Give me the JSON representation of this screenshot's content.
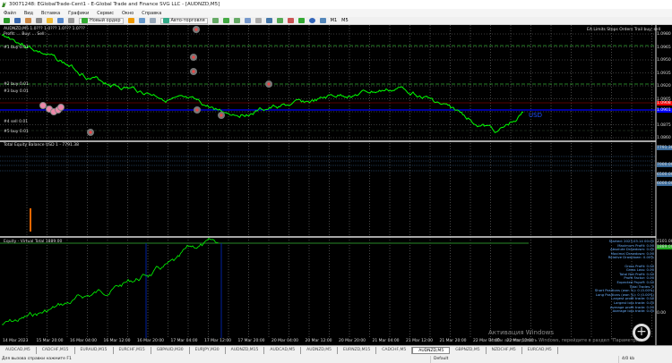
{
  "window": {
    "title": "30071248: EGlobalTrade-Cent1 - E-Global Trade and Finance SVG LLC - [AUDNZD,M5]"
  },
  "menu": [
    "Файл",
    "Вид",
    "Вставка",
    "Графики",
    "Сервис",
    "Окно",
    "Справка"
  ],
  "toolbar": {
    "new_order": "Новый ордер",
    "autotrading": "Авто-торговля",
    "periods": [
      "M1",
      "M5"
    ]
  },
  "chart": {
    "symbol_line": "AUDNZD,M5 1.0??? 1.0??? 1.0??? 1.0???",
    "ea_line": "Profit: ... Buy: ... Sell: ...",
    "right_info": "EA Limits Stops Orders Trail buy: sell",
    "currency_label": "USD",
    "order_labels": [
      "#1 buy 0.01",
      "#2 buy 0.01",
      "#3 buy 0.01",
      "#4 sell 0.01",
      "#5 buy 0.01"
    ],
    "price_scale": [
      "1.0980",
      "1.0965",
      "1.0950",
      "1.0935",
      "1.0920",
      "1.0905",
      "1.0890",
      "1.0875",
      "1.0860"
    ],
    "current_price": "1.0908",
    "bid_price": "1.0901",
    "indicator_title": "Total Equity Balance USD 1 - 7791.38",
    "indicator_scale": [
      "7791.38",
      "7000.00",
      "6500.00",
      "6000.00"
    ],
    "equity_title": "Equity - Virtual Total 1889.00",
    "equity_scale": [
      "2101.00",
      "1889.00",
      "0.00"
    ],
    "stats": [
      "Started: 2023.03.14 00:00",
      "Maximum Profit: 0.00",
      "Absolute Drawdown: 0.00",
      "Maximal Drawdown: 0.00",
      "Relative Drawdown: 0.00%",
      "",
      "Gross Profit: 0.00",
      "Gross Loss: 0.00",
      "Total Net Profit: 0.00",
      "Profit Factor: 0.00",
      "Expected Payoff: 0.00",
      "Total Trades: 0",
      "Short Positions (won %): 0 (0.00%)",
      "Long Positions (won %): 0 (0.00%)",
      "Largest profit trade: 0.00",
      "Largest loss trade: 0.00",
      "Average profit trade: 0.00",
      "Average loss trade: 0.00"
    ],
    "time_axis": [
      "14 Mar 2023",
      "15 Mar 20:00",
      "16 Mar 04:00",
      "16 Mar 12:00",
      "16 Mar 20:00",
      "17 Mar 04:00",
      "17 Mar 12:00",
      "17 Mar 20:00",
      "20 Mar 04:00",
      "20 Mar 12:00",
      "20 Mar 20:00",
      "21 Mar 04:00",
      "21 Mar 12:00",
      "21 Mar 20:00",
      "22 Mar 04:00",
      "22 Mar 12:00"
    ],
    "colors": {
      "price": "#00ff00",
      "bg": "#000000",
      "bid_line": "#0000ff",
      "ask_line": "#ff0000"
    }
  },
  "watermark": {
    "title": "Активация Windows",
    "sub": "Чтобы активировать Windows, перейдите в раздел \"Параметры\"."
  },
  "tabs": [
    {
      "label": "AUDCAD,M5"
    },
    {
      "label": "CADCHF,M15"
    },
    {
      "label": "EURAUD,M15"
    },
    {
      "label": "EURCHF,M15"
    },
    {
      "label": "GBPAUD,M30"
    },
    {
      "label": "EURJPY,M30"
    },
    {
      "label": "AUDNZD,M15"
    },
    {
      "label": "AUDCAD,M5"
    },
    {
      "label": "AUDNZD,M5"
    },
    {
      "label": "EURNZD,M15"
    },
    {
      "label": "CADCHF,M5"
    },
    {
      "label": "AUDNZD,M5",
      "active": true
    },
    {
      "label": "GBPNZD,M5"
    },
    {
      "label": "NZDCHF,M5"
    },
    {
      "label": "EURCAD,M5"
    }
  ],
  "status": {
    "help": "Для вызова справки нажмите F1",
    "profile": "Default",
    "connection": "4/0 kb"
  }
}
